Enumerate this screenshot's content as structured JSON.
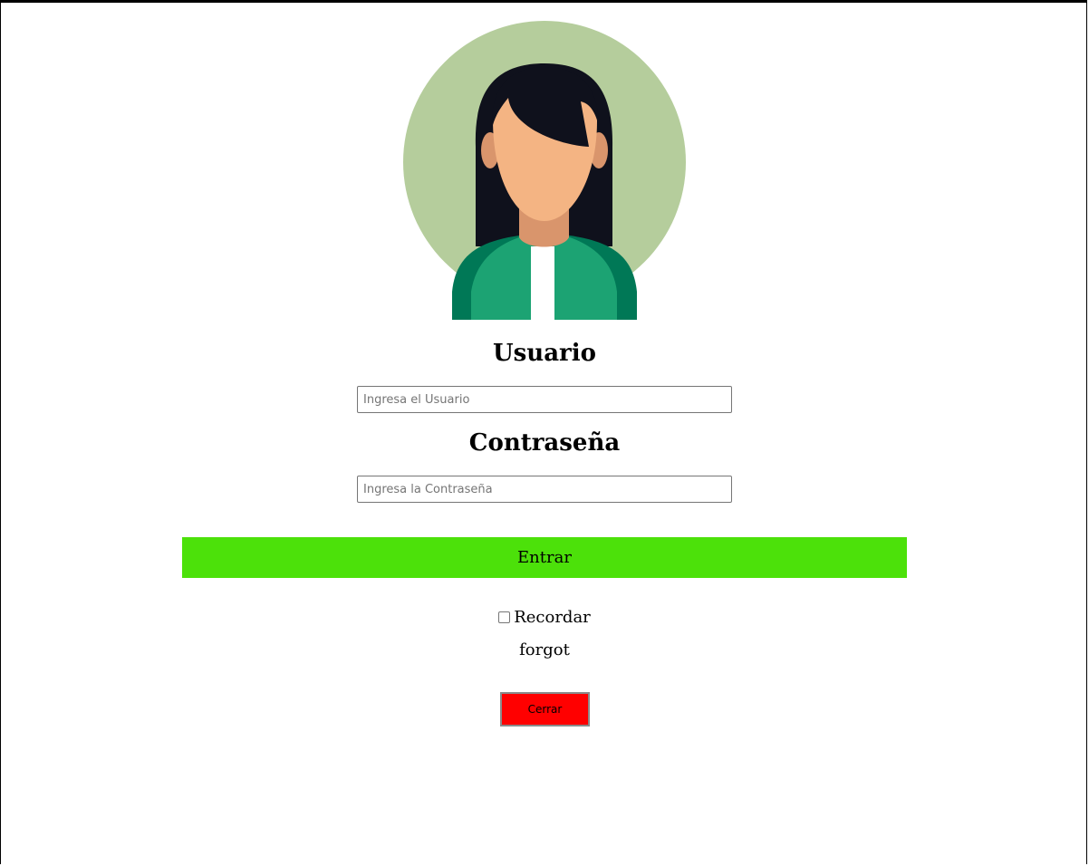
{
  "avatar": {
    "icon": "woman-avatar-icon",
    "colors": {
      "circle": "#b5cd9c",
      "hair": "#0f111c",
      "skin": "#f4b483",
      "neck": "#d9956c",
      "jacket": "#1ca373",
      "jacket_dark": "#007856",
      "shirt": "#ffffff"
    }
  },
  "form": {
    "user_label": "Usuario",
    "user_placeholder": "Ingresa el Usuario",
    "user_value": "",
    "password_label": "Contraseña",
    "password_placeholder": "Ingresa la Contraseña",
    "password_value": "",
    "submit_label": "Entrar",
    "remember_label": "Recordar",
    "remember_checked": false,
    "forgot_label": "forgot",
    "close_label": "Cerrar"
  },
  "colors": {
    "submit_bg": "#4ce10a",
    "close_bg": "#ff0000"
  }
}
